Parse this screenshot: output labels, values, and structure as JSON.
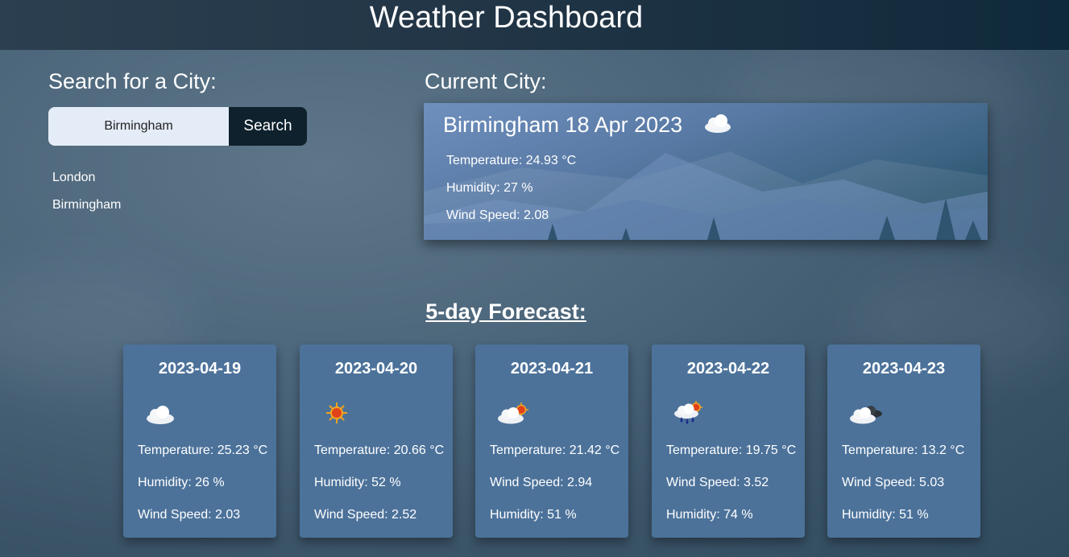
{
  "header": {
    "title": "Weather Dashboard"
  },
  "search": {
    "title": "Search for a City:",
    "input_value": "Birmingham",
    "button_label": "Search",
    "history": [
      "London",
      "Birmingham"
    ]
  },
  "current": {
    "title": "Current City:",
    "heading": "Birmingham 18 Apr 2023",
    "icon": "cloud-icon",
    "temperature": "Temperature: 24.93 °C",
    "humidity": "Humidity: 27 %",
    "wind": "Wind Speed: 2.08"
  },
  "forecast": {
    "title": "5-day Forecast:",
    "days": [
      {
        "date": "2023-04-19",
        "icon": "cloud-icon",
        "line1": "Temperature: 25.23 °C",
        "line2": "Humidity: 26 %",
        "line3": "Wind Speed: 2.03"
      },
      {
        "date": "2023-04-20",
        "icon": "sun-icon",
        "line1": "Temperature: 20.66 °C",
        "line2": "Humidity: 52 %",
        "line3": "Wind Speed: 2.52"
      },
      {
        "date": "2023-04-21",
        "icon": "partly-cloudy-icon",
        "line1": "Temperature: 21.42 °C",
        "line2": "Wind Speed: 2.94",
        "line3": "Humidity: 51 %"
      },
      {
        "date": "2023-04-22",
        "icon": "rain-sun-icon",
        "line1": "Temperature: 19.75 °C",
        "line2": "Wind Speed: 3.52",
        "line3": "Humidity: 74 %"
      },
      {
        "date": "2023-04-23",
        "icon": "overcast-icon",
        "line1": "Temperature: 13.2 °C",
        "line2": "Wind Speed: 5.03",
        "line3": "Humidity: 51 %"
      }
    ]
  }
}
